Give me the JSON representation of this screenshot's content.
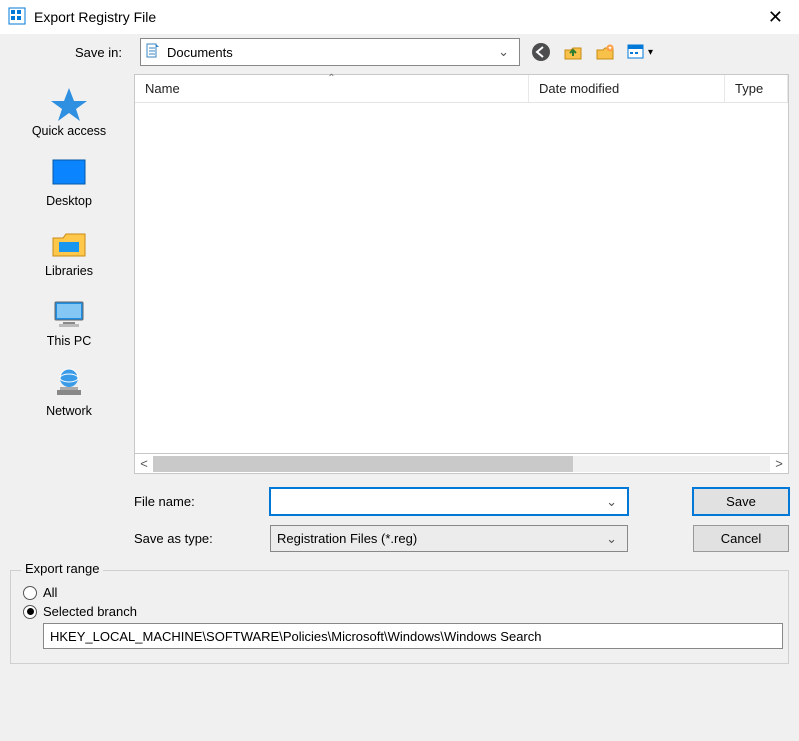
{
  "window": {
    "title": "Export Registry File",
    "close_tooltip": "Close"
  },
  "toolbar": {
    "save_in_label": "Save in:",
    "current_folder": "Documents",
    "back_tooltip": "Back",
    "up_tooltip": "Up one level",
    "newfolder_tooltip": "Create New Folder",
    "viewmenu_tooltip": "View Menu"
  },
  "places": [
    {
      "id": "quickaccess",
      "label": "Quick access"
    },
    {
      "id": "desktop",
      "label": "Desktop"
    },
    {
      "id": "libraries",
      "label": "Libraries"
    },
    {
      "id": "thispc",
      "label": "This PC"
    },
    {
      "id": "network",
      "label": "Network"
    }
  ],
  "columns": {
    "name": "Name",
    "date_modified": "Date modified",
    "type": "Type",
    "sorted_by": "name",
    "sort_dir": "asc"
  },
  "file_list": {
    "rows": []
  },
  "form": {
    "file_name_label": "File name:",
    "file_name_value": "",
    "save_as_type_label": "Save as type:",
    "save_as_type_value": "Registration Files (*.reg)",
    "save_button": "Save",
    "cancel_button": "Cancel"
  },
  "export_range": {
    "legend": "Export range",
    "all_label": "All",
    "selected_branch_label": "Selected branch",
    "selected_option": "selected_branch",
    "branch_path": "HKEY_LOCAL_MACHINE\\SOFTWARE\\Policies\\Microsoft\\Windows\\Windows Search"
  }
}
